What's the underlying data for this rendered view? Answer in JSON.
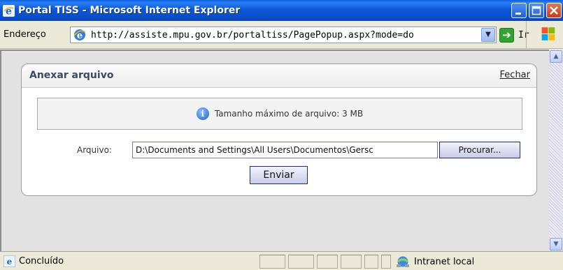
{
  "window": {
    "title": "Portal TISS - Microsoft Internet Explorer",
    "minimize_icon": "minimize-icon",
    "maximize_icon": "maximize-icon",
    "close_icon": "close-icon"
  },
  "addressbar": {
    "label": "Endereço",
    "url": "http://assiste.mpu.gov.br/portaltiss/PagePopup.aspx?mode=do",
    "go_label": "Ir"
  },
  "panel": {
    "title": "Anexar arquivo",
    "close_label": "Fechar",
    "info_icon": "info-icon",
    "info_text": "Tamanho máximo de arquivo: 3 MB",
    "file_label": "Arquivo:",
    "file_value": "D:\\Documents and Settings\\All Users\\Documentos\\Gersc",
    "browse_label": "Procurar...",
    "send_label": "Enviar"
  },
  "statusbar": {
    "status_text": "Concluído",
    "zone_text": "Intranet local"
  },
  "colors": {
    "titlebar": "#0a58d8",
    "chrome": "#ece9d8",
    "content_bg": "#e2e2e2",
    "panel_title": "#3c4a5e"
  }
}
